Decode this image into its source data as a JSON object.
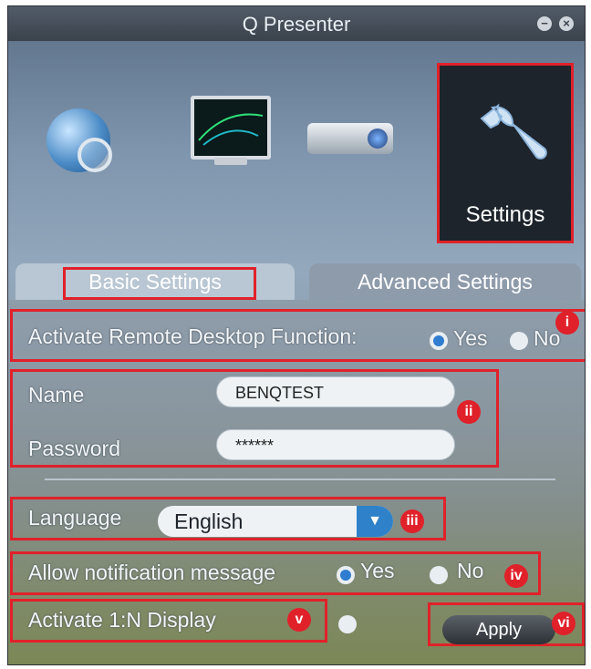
{
  "window": {
    "title": "Q Presenter",
    "minimize_glyph": "−",
    "close_glyph": "×"
  },
  "modes": {
    "settings_label": "Settings",
    "icons": [
      "globe-search-icon",
      "monitor-icon",
      "projector-icon",
      "wrench-icon"
    ]
  },
  "tabs": {
    "basic": "Basic Settings",
    "advanced": "Advanced Settings"
  },
  "remote_desktop": {
    "label": "Activate Remote Desktop Function:",
    "yes": "Yes",
    "no": "No",
    "selected": "Yes"
  },
  "credentials": {
    "name_label": "Name",
    "name_value": "BENQTEST",
    "password_label": "Password",
    "password_value": "******"
  },
  "language": {
    "label": "Language",
    "selected": "English",
    "arrow_glyph": "▼"
  },
  "notification": {
    "label": "Allow notification message",
    "yes": "Yes",
    "no": "No",
    "selected": "Yes"
  },
  "one_to_n": {
    "label": "Activate 1:N Display"
  },
  "apply_label": "Apply",
  "annotations": [
    "i",
    "ii",
    "iii",
    "iv",
    "v",
    "vi"
  ],
  "colors": {
    "highlight": "#e0212a",
    "radio_on": "#2f7dd0",
    "dropdown_accent": "#2f82c9"
  }
}
